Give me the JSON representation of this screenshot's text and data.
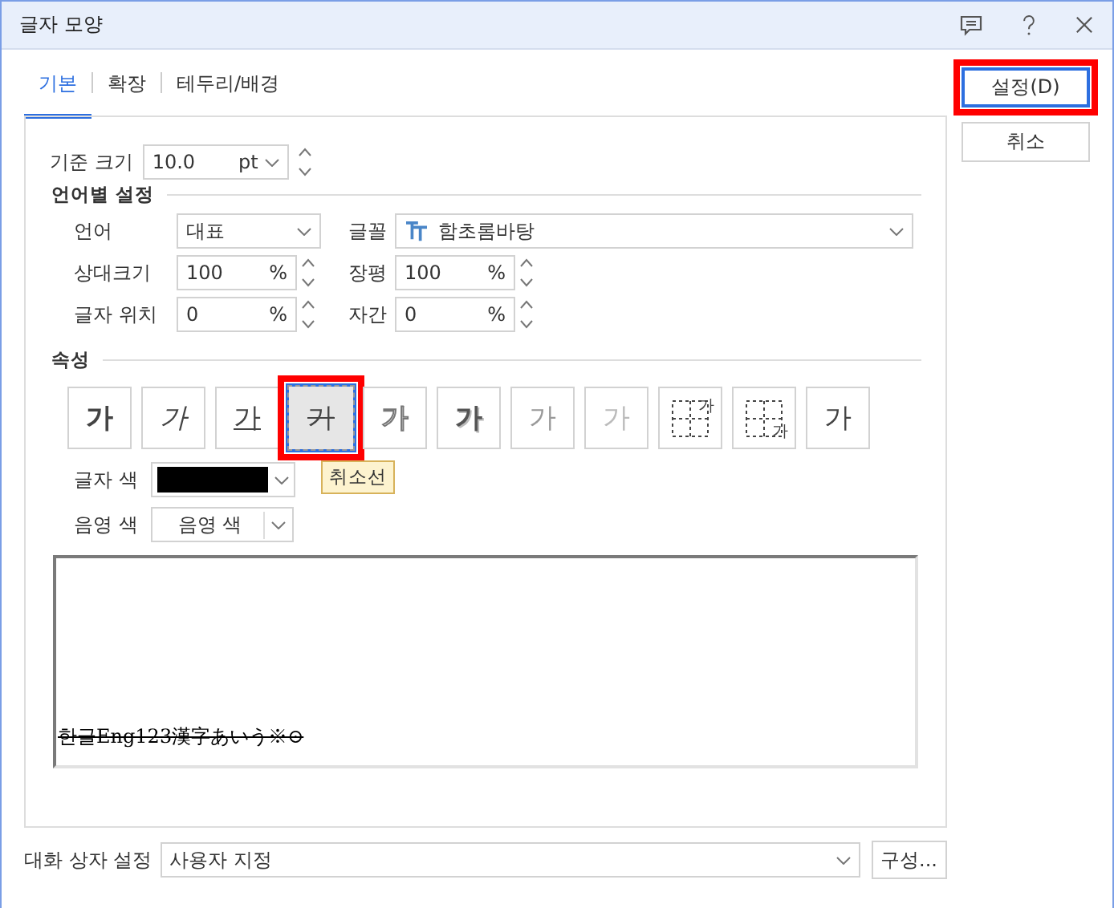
{
  "window": {
    "title": "글자 모양"
  },
  "tabs": [
    {
      "label": "기본",
      "selected": true
    },
    {
      "label": "확장",
      "selected": false
    },
    {
      "label": "테두리/배경",
      "selected": false
    }
  ],
  "base_size": {
    "label": "기준 크기",
    "value": "10.0",
    "unit": "pt"
  },
  "language_section": {
    "title": "언어별 설정",
    "language": {
      "label": "언어",
      "value": "대표"
    },
    "font": {
      "label": "글꼴",
      "value": "함초롬바탕"
    },
    "relative_size": {
      "label": "상대크기",
      "value": "100",
      "unit": "%"
    },
    "width_ratio": {
      "label": "장평",
      "value": "100",
      "unit": "%"
    },
    "position": {
      "label": "글자 위치",
      "value": "0",
      "unit": "%"
    },
    "spacing": {
      "label": "자간",
      "value": "0",
      "unit": "%"
    }
  },
  "attributes": {
    "title": "속성",
    "tooltip": "취소선",
    "buttons": [
      {
        "kind": "bold",
        "glyph": "가",
        "selected": false,
        "highlighted": false
      },
      {
        "kind": "italic",
        "glyph": "가",
        "selected": false,
        "highlighted": false
      },
      {
        "kind": "underline",
        "glyph": "가",
        "selected": false,
        "highlighted": false
      },
      {
        "kind": "strikethrough",
        "glyph": "가",
        "selected": true,
        "highlighted": true
      },
      {
        "kind": "outline",
        "glyph": "가",
        "selected": false,
        "highlighted": false
      },
      {
        "kind": "shadow",
        "glyph": "가",
        "selected": false,
        "highlighted": false
      },
      {
        "kind": "emboss",
        "glyph": "가",
        "selected": false,
        "highlighted": false
      },
      {
        "kind": "engrave",
        "glyph": "가",
        "selected": false,
        "highlighted": false
      },
      {
        "kind": "superscript",
        "glyph": "가",
        "selected": false,
        "highlighted": false
      },
      {
        "kind": "subscript",
        "glyph": "가",
        "selected": false,
        "highlighted": false
      },
      {
        "kind": "normal",
        "glyph": "가",
        "selected": false,
        "highlighted": false
      }
    ]
  },
  "text_color": {
    "label": "글자 색",
    "color": "#000000"
  },
  "shade_color": {
    "label": "음영 색",
    "value": "음영 색"
  },
  "preview": {
    "text": "한글Eng123漢字あいう※⊙",
    "strikethrough": true
  },
  "dialog_settings": {
    "label": "대화 상자 설정",
    "value": "사용자 지정",
    "configure": "구성..."
  },
  "buttons": [
    {
      "label": "설정(D)",
      "highlighted": true
    },
    {
      "label": "취소",
      "highlighted": false
    }
  ]
}
